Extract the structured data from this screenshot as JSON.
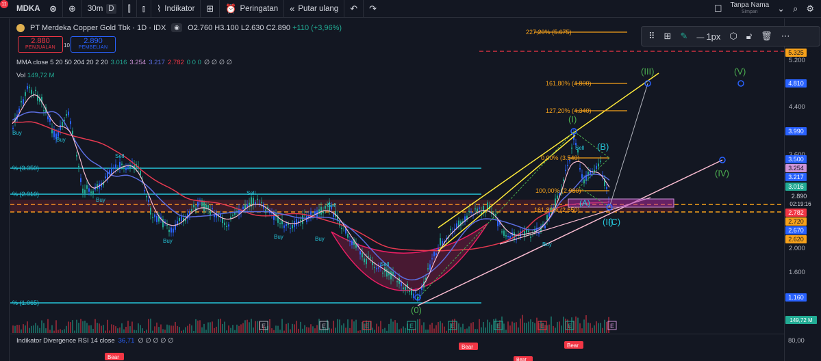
{
  "topbar": {
    "notif_count": "11",
    "symbol": "MDKA",
    "interval": "30m",
    "interval_d": "D",
    "indicators_label": "Indikator",
    "alert_label": "Peringatan",
    "replay_label": "Putar ulang",
    "user_name": "Tanpa Nama",
    "user_status": "Simpan"
  },
  "legend": {
    "title": "PT Merdeka Copper Gold Tbk · 1D · IDX",
    "open": "O2.760",
    "high": "H3.100",
    "low": "L2.630",
    "close": "C2.890",
    "change": "+110 (+3,96%)"
  },
  "trade": {
    "sell_price": "2.880",
    "sell_label": "PENJUALAN",
    "spread": "10",
    "buy_price": "2.890",
    "buy_label": "PEMBELIAN"
  },
  "indicators": {
    "mma_label": "MMA close 5 20 50 204 20 2 20",
    "mma_v1": "3.016",
    "mma_v2": "3.254",
    "mma_v3": "3.217",
    "mma_v4": "2.782",
    "mma_zeros": "0 0 0",
    "mma_nulls": "∅ ∅ ∅ ∅",
    "vol_label": "Vol",
    "vol_value": "149,72 M",
    "rsi_label": "Indikator Divergence RSI 14 close",
    "rsi_value": "36,71",
    "rsi_nulls": "∅ ∅ ∅ ∅ ∅"
  },
  "drawbar": {
    "width_label": "1px"
  },
  "axis": {
    "ticks": [
      "5.200",
      "4.400",
      "3.600",
      "2.000",
      "1.600",
      "80,00"
    ],
    "labels": {
      "l5325": "5.325",
      "l4810": "4.810",
      "l3990": "3.990",
      "l3500": "3.500",
      "l3254": "3.254",
      "l3217": "3.217",
      "l3016": "3.016",
      "l2890": "2.890",
      "countdown": "02:19:16",
      "l2782": "2.782",
      "l2720": "2.720",
      "l2670": "2.670",
      "l2620": "2.620",
      "l1160": "1.160",
      "vol": "149,72 M"
    }
  },
  "fib": {
    "f2272": "227,20% (5.675)",
    "f1618": "161,80% (4.800)",
    "f1272": "127,20% (4.340)",
    "f000": "0,00% (3.540)",
    "f100": "100,00% (2.980)",
    "f1618b": "161,80% (2.650)",
    "h3350": "% (3.350)",
    "h2910": "% (2.910)",
    "h1065": "% (1.065)"
  },
  "waves": {
    "w0": "(0)",
    "wI": "(I)",
    "wII": "(II)",
    "wIII": "(III)",
    "wIV": "(IV)",
    "wV": "(V)",
    "wA": "(A)",
    "wB": "(B)",
    "wC": "(C)"
  },
  "signals": {
    "sell": "Sell",
    "buy": "Buy",
    "bear": "Bear",
    "e": "E"
  },
  "colors": {
    "bg": "#131722",
    "up": "#22ab94",
    "down": "#f23645",
    "cyan": "#26c6da",
    "fib": "#f7a21b",
    "yellow": "#ffeb3b",
    "pink": "#f8bbd0",
    "wave": "#4caf50"
  }
}
